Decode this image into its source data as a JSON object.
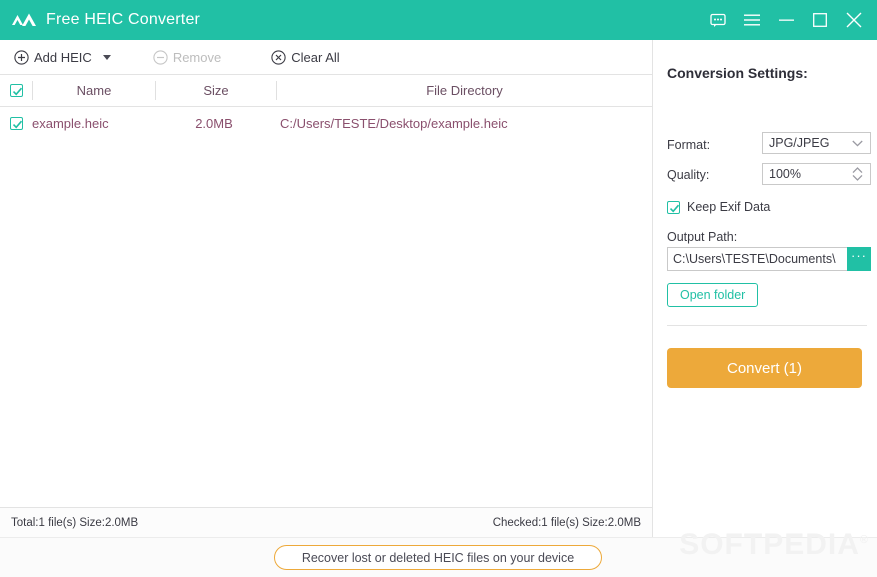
{
  "window": {
    "title": "Free HEIC Converter",
    "logo_icon": "mountain-peaks-icon",
    "controls": [
      {
        "name": "feedback-icon",
        "label": "Feedback"
      },
      {
        "name": "menu-icon",
        "label": "Menu"
      },
      {
        "name": "minimize-icon",
        "label": "Minimize"
      },
      {
        "name": "maximize-icon",
        "label": "Maximize"
      },
      {
        "name": "close-icon",
        "label": "Close"
      }
    ],
    "accent_color": "#21c0a5"
  },
  "toolbar": {
    "add_label": "Add HEIC",
    "add_icon": "plus-circle-icon",
    "add_dropdown_icon": "caret-down-icon",
    "remove_label": "Remove",
    "remove_icon": "minus-circle-icon",
    "remove_enabled": false,
    "clear_label": "Clear All",
    "clear_icon": "x-circle-icon"
  },
  "file_list": {
    "columns": [
      "Name",
      "Size",
      "File Directory"
    ],
    "select_all_checked": true,
    "rows": [
      {
        "checked": true,
        "name": "example.heic",
        "size": "2.0MB",
        "directory": "C:/Users/TESTE/Desktop/example.heic"
      }
    ]
  },
  "settings": {
    "title": "Conversion Settings:",
    "format_label": "Format:",
    "format_value": "JPG/JPEG",
    "format_options": [
      "JPG/JPEG"
    ],
    "quality_label": "Quality:",
    "quality_value": "100%",
    "exif_label": "Keep Exif Data",
    "exif_checked": true,
    "output_label": "Output Path:",
    "output_value": "C:\\Users\\TESTE\\Documents\\",
    "browse_label": "···",
    "open_folder_label": "Open folder",
    "convert_label": "Convert (1)",
    "convert_color": "#eda93a"
  },
  "status": {
    "left": "Total:1 file(s) Size:2.0MB",
    "right": "Checked:1 file(s) Size:2.0MB"
  },
  "bottom": {
    "recover_label": "Recover lost or deleted HEIC files on your device",
    "watermark": "SOFTPEDIA"
  }
}
